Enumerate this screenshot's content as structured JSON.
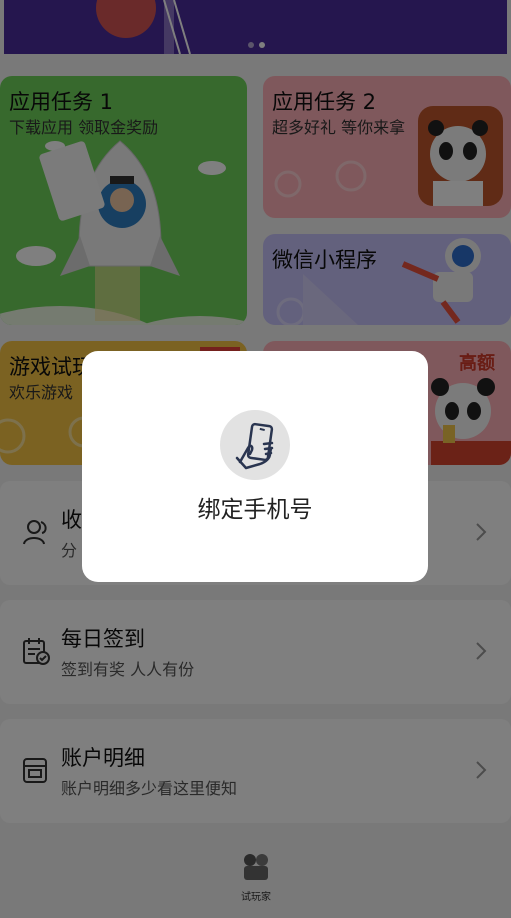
{
  "cards": {
    "task1": {
      "title": "应用任务 1",
      "subtitle": "下载应用 领取金奖励"
    },
    "task2": {
      "title": "应用任务 2",
      "subtitle": "超多好礼 等你来拿"
    },
    "wechat": {
      "title": "微信小程序"
    },
    "game": {
      "title": "游戏试玩",
      "subtitle": "欢乐游戏"
    },
    "fourth": {
      "badge": "高额"
    }
  },
  "rows": [
    {
      "title": "收",
      "subtitle": "分",
      "icon": "user-icon"
    },
    {
      "title": "每日签到",
      "subtitle": "签到有奖 人人有份",
      "icon": "calendar-check-icon"
    },
    {
      "title": "账户明细",
      "subtitle": "账户明细多少看这里便知",
      "icon": "wallet-icon"
    }
  ],
  "footer": {
    "label": "试玩家"
  },
  "dialog": {
    "message": "绑定手机号",
    "icon": "phone-in-hand-icon"
  }
}
